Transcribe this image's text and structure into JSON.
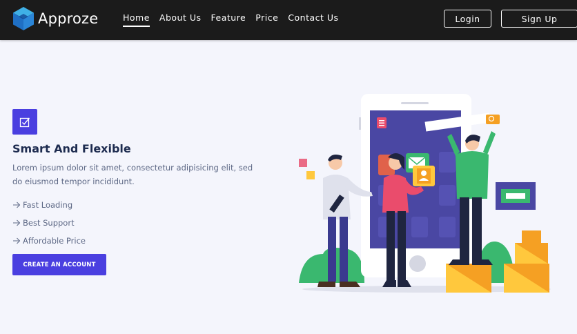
{
  "brand": {
    "name": "Approze"
  },
  "nav": {
    "links": [
      {
        "label": "Home",
        "active": true
      },
      {
        "label": "About Us"
      },
      {
        "label": "Feature"
      },
      {
        "label": "Price"
      },
      {
        "label": "Contact Us"
      }
    ],
    "login_label": "Login",
    "signup_label": "Sign Up"
  },
  "hero": {
    "title": "Smart And Flexible",
    "description": "Lorem ipsum dolor sit amet, consectetur adipisicing elit, sed do eiusmod tempor incididunt.",
    "points": [
      "Fast Loading",
      "Best Support",
      "Affordable Price"
    ],
    "cta_label": "CREATE AN ACCOUNT",
    "icon": "check-square-icon"
  },
  "colors": {
    "accent": "#4a3fe0",
    "navbar": "#1b1b1b",
    "background": "#f4f5fc",
    "heading": "#1d2b4f",
    "body_text": "#5d6885"
  }
}
